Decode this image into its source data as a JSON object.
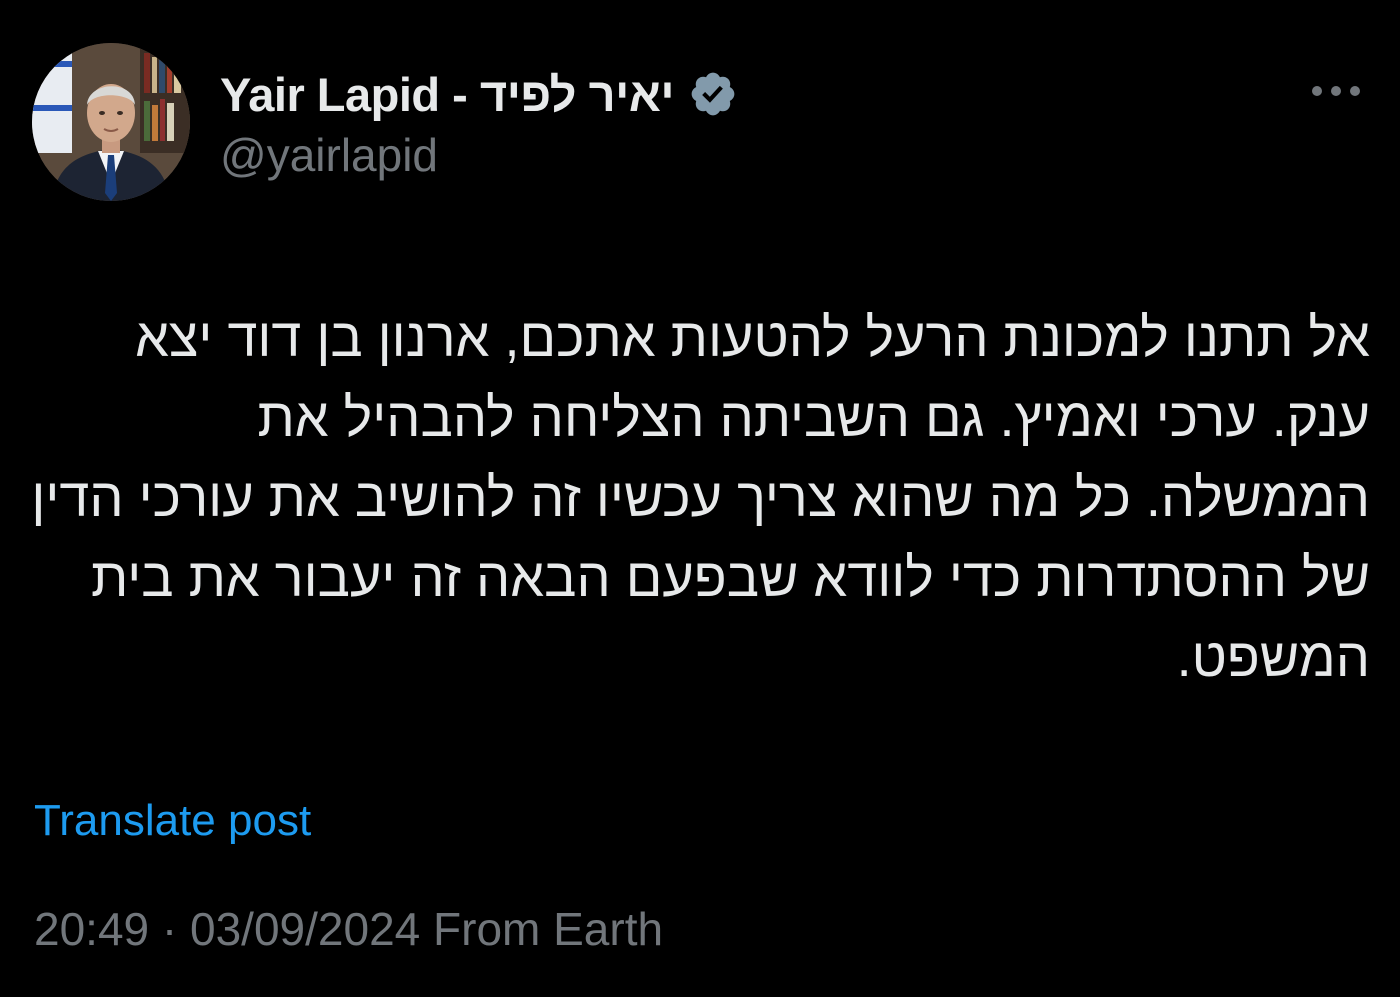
{
  "author": {
    "display_name": "Yair Lapid - יאיר לפיד",
    "handle": "@yairlapid",
    "verified": true,
    "avatar_icon": "profile-photo"
  },
  "post": {
    "text": "אל תתנו למכונת הרעל להטעות אתכם, ארנון בן דוד יצא ענק. ערכי ואמיץ. גם השביתה הצליחה להבהיל את הממשלה. כל מה שהוא צריך עכשיו זה להושיב את עורכי הדין של ההסתדרות כדי לוודא שבפעם הבאה זה יעבור את בית המשפט."
  },
  "translate_label": "Translate post",
  "meta": {
    "time": "20:49",
    "separator": "·",
    "date": "03/09/2024",
    "source": "From Earth"
  },
  "colors": {
    "background": "#000000",
    "text": "#e7e9ea",
    "secondary": "#71767b",
    "link": "#1d9bf0",
    "verified_badge": "#829aab"
  },
  "icons": {
    "more": "more-horizontal-icon",
    "verified": "verified-badge-icon"
  }
}
